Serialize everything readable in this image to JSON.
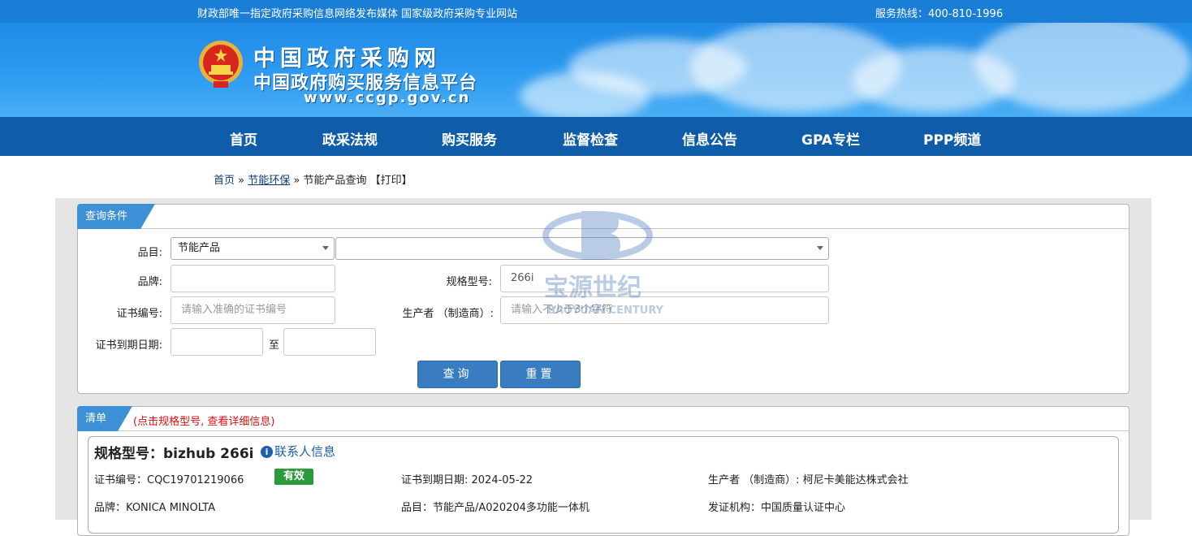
{
  "topbar": {
    "slogan": "财政部唯一指定政府采购信息网络发布媒体 国家级政府采购专业网站",
    "hotline": "服务热线：400-810-1996"
  },
  "logo": {
    "title": "中国政府采购网",
    "subtitle": "中国政府购买服务信息平台",
    "url": "www.ccgp.gov.cn"
  },
  "nav": [
    "首页",
    "政采法规",
    "购买服务",
    "监督检查",
    "信息公告",
    "GPA专栏",
    "PPP频道"
  ],
  "breadcrumb": {
    "home": "首页",
    "sep1": " » ",
    "section": "节能环保",
    "sep2": " » ",
    "current": "节能产品查询",
    "print": "【打印】"
  },
  "query": {
    "tab": "查询条件",
    "category_label": "品目:",
    "category_value": "节能产品",
    "subcategory_value": "",
    "brand_label": "品牌:",
    "brand_value": "",
    "model_label": "规格型号:",
    "model_value": "266i",
    "cert_label": "证书编号:",
    "cert_placeholder": "请输入准确的证书编号",
    "producer_label": "生产者 （制造商）:",
    "producer_placeholder": "请输入不少于3个字符",
    "expiry_label": "证书到期日期:",
    "to_label": "至",
    "search_button": "查询",
    "reset_button": "重置"
  },
  "results": {
    "tab": "清单",
    "hint": "(点击规格型号, 查看详细信息)",
    "item": {
      "title": "规格型号：bizhub 266i",
      "contact": "联系人信息",
      "cert": "证书编号：CQC19701219066",
      "status": "有效",
      "expiry": "证书到期日期: 2024-05-22",
      "producer": "生产者 （制造商）: 柯尼卡美能达株式会社",
      "brand": "品牌：KONICA MINOLTA",
      "category": "品目：节能产品/A020204多功能一体机",
      "issuer": "发证机构：中国质量认证中心"
    }
  },
  "watermark": {
    "cn": "宝源世纪",
    "en": "BAOYUAN CENTURY"
  },
  "colors": {
    "top_strip": "#1b7ed6",
    "nav": "#0f5da8",
    "tab": "#3d8fd6",
    "button": "#3a7cc0",
    "badge": "#2a9a3a",
    "hint": "#dd1111"
  }
}
